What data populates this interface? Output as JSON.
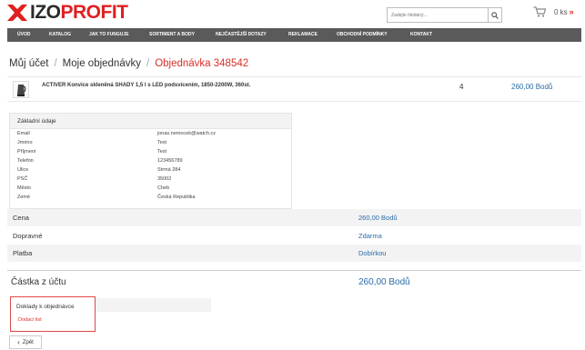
{
  "header": {
    "logo": {
      "part1": "IZO",
      "part2": "PROFIT"
    },
    "search": {
      "placeholder": "Zadejte hledaný..."
    },
    "cart": {
      "price": "0 ks",
      "arrow": "»"
    }
  },
  "nav": {
    "items": [
      {
        "label": "Úvod"
      },
      {
        "label": "Katalog"
      },
      {
        "label": "Jak to funguje"
      },
      {
        "label": "Sortiment a body"
      },
      {
        "label": "Nejčastější dotazy"
      },
      {
        "label": "Reklamace"
      },
      {
        "label": "Obchodní podmínky"
      },
      {
        "label": "Kontakt"
      }
    ]
  },
  "breadcrumb": {
    "items": [
      "Můj účet",
      "Moje objednávky",
      "Objednávka 348542"
    ],
    "separator": "/"
  },
  "order_item": {
    "name": "ACTIVER Konvice skleněná SHADY 1,5 l s LED podsvícením, 1850-2200W, 360st.",
    "quantity": "4",
    "price": "260,00 Bodů"
  },
  "basic_info": {
    "title": "Základní údaje",
    "fields": [
      {
        "label": "Email",
        "value": "jonas.nemocek@watch.cz"
      },
      {
        "label": "Jméno",
        "value": "Test"
      },
      {
        "label": "Příjmení",
        "value": "Test"
      },
      {
        "label": "Telefon",
        "value": "123456789"
      },
      {
        "label": "Ulice",
        "value": "Strmá 284"
      },
      {
        "label": "PSČ",
        "value": "35002"
      },
      {
        "label": "Město",
        "value": "Cheb"
      },
      {
        "label": "Země",
        "value": "Česká Republika"
      }
    ]
  },
  "summary": {
    "rows": [
      {
        "label": "Cena",
        "value": "260,00 Bodů"
      },
      {
        "label": "Dopravné",
        "value": "Zdarma"
      },
      {
        "label": "Platba",
        "value": "Dobírkou"
      }
    ],
    "total": {
      "label": "Částka z účtu",
      "value": "260,00 Bodů"
    }
  },
  "documents": {
    "title": "Doklady k objednávce",
    "link": "Dodací list"
  },
  "back_button": {
    "arrow": "‹",
    "label": "Zpět"
  },
  "colors": {
    "accent": "#e02020",
    "link": "#2a6ca8",
    "nav": "#5a5a5a"
  }
}
